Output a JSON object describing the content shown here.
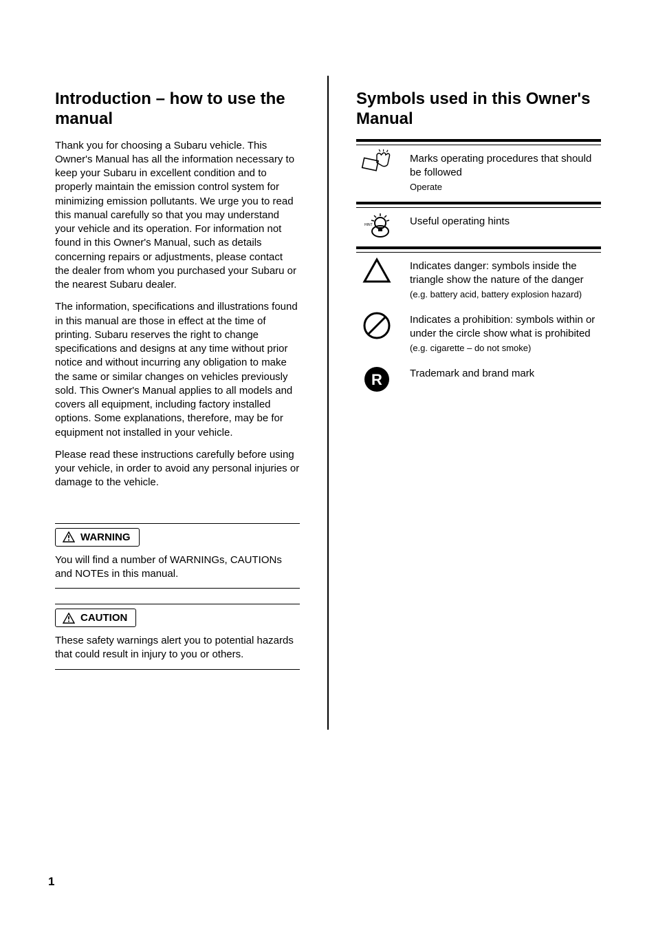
{
  "left": {
    "heading": "Introduction – how to use the manual",
    "paragraphs": [
      "Thank you for choosing a Subaru vehicle. This Owner's Manual has all the information necessary to keep your Subaru in excellent condition and to properly maintain the emission control system for minimizing emission pollutants. We urge you to read this manual carefully so that you may understand your vehicle and its operation. For information not found in this Owner's Manual, such as details concerning repairs or adjustments, please contact the dealer from whom you purchased your Subaru or the nearest Subaru dealer.",
      "The information, specifications and illustrations found in this manual are those in effect at the time of printing. Subaru reserves the right to change specifications and designs at any time without prior notice and without incurring any obligation to make the same or similar changes on vehicles previously sold. This Owner's Manual applies to all models and covers all equipment, including factory installed options. Some explanations, therefore, may be for equipment not installed in your vehicle.",
      "Please read these instructions carefully before using your vehicle, in order to avoid any personal injuries or damage to the vehicle."
    ],
    "warning_label": "WARNING",
    "warning_text": "You will find a number of WARNINGs, CAUTIONs and NOTEs in this manual.",
    "caution_label": "CAUTION",
    "caution_text": "These safety warnings alert you to potential hazards that could result in injury to you or others."
  },
  "right": {
    "heading": "Symbols used in this Owner's Manual",
    "rows": [
      {
        "icon": "hand-pointer-icon",
        "line1": "Marks operating procedures that should be followed",
        "line2": "Operate"
      },
      {
        "icon": "lightbulb-hint-icon",
        "line1": "Useful operating hints",
        "line2": ""
      },
      {
        "icon": "triangle-outline-icon",
        "line1": "Indicates danger: symbols inside the triangle show the nature of the danger",
        "line2": "(e.g. battery acid, battery explosion hazard)"
      },
      {
        "icon": "no-entry-icon",
        "line1": "Indicates a prohibition: symbols within or under the circle show what is prohibited",
        "line2": "(e.g. cigarette – do not smoke)"
      },
      {
        "icon": "r-circle-icon",
        "line1": "Trademark and brand mark",
        "line2": ""
      }
    ]
  },
  "page_number": "1"
}
